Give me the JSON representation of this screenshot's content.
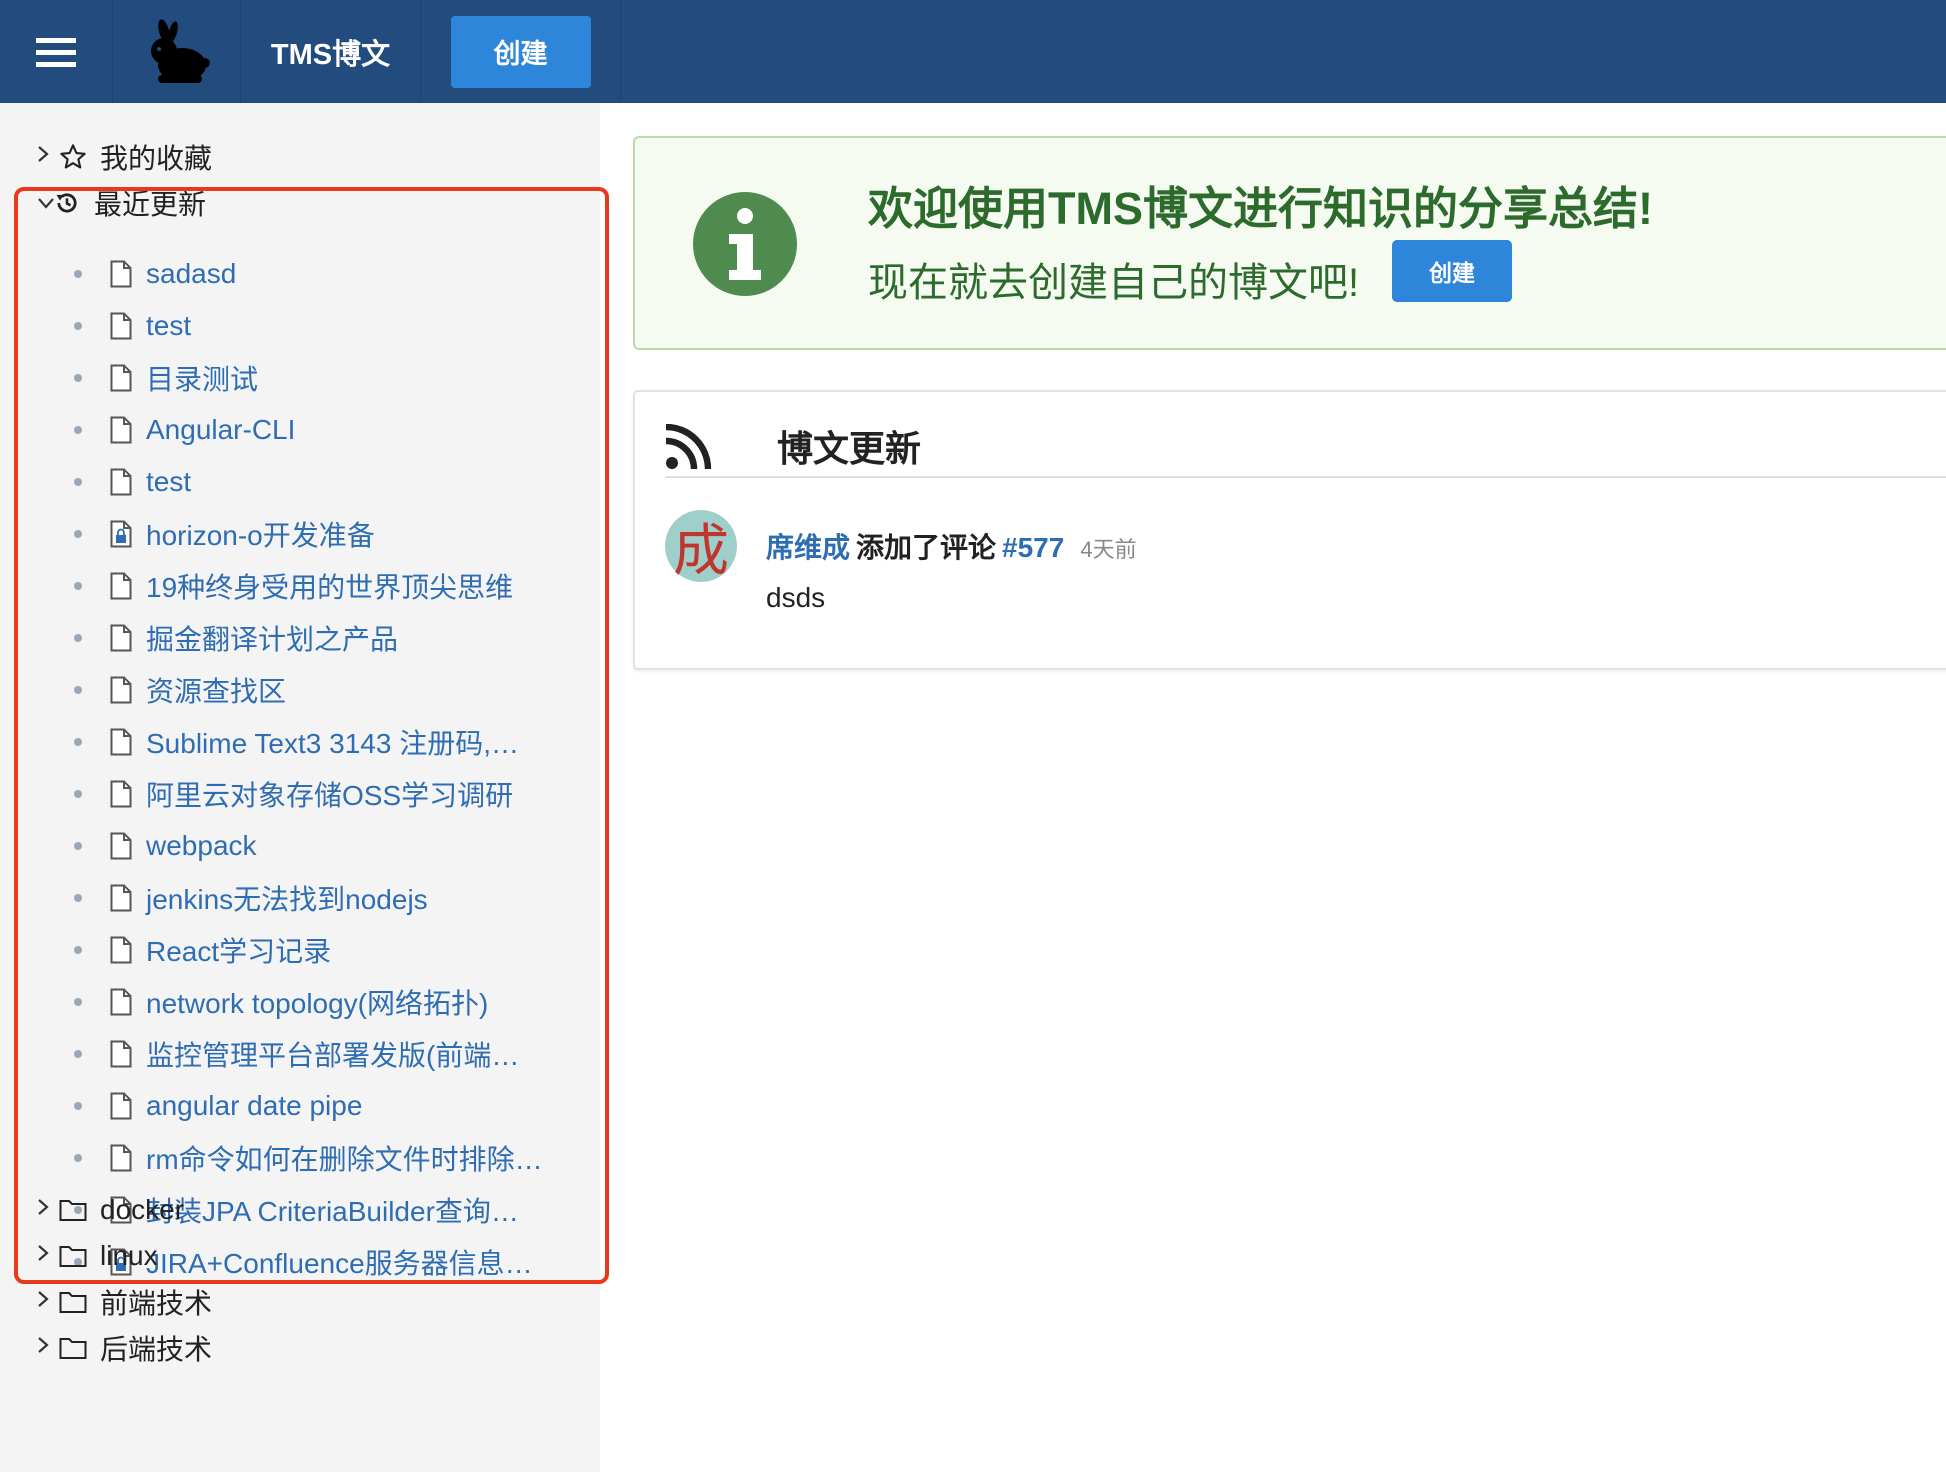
{
  "header": {
    "title": "TMS博文",
    "create_label": "创建",
    "menu_icon": "hamburger-icon",
    "logo_icon": "rabbit-logo"
  },
  "sidebar": {
    "favorites_label": "我的收藏",
    "recent_label": "最近更新",
    "recent_items": [
      {
        "label": "sadasd",
        "icon": "document-icon"
      },
      {
        "label": "test",
        "icon": "document-icon"
      },
      {
        "label": "目录测试",
        "icon": "document-icon"
      },
      {
        "label": "Angular-CLI",
        "icon": "document-icon"
      },
      {
        "label": "test",
        "icon": "document-icon"
      },
      {
        "label": "horizon-o开发准备",
        "icon": "locked-document-icon"
      },
      {
        "label": "19种终身受用的世界顶尖思维",
        "icon": "document-icon"
      },
      {
        "label": "掘金翻译计划之产品",
        "icon": "document-icon"
      },
      {
        "label": "资源查找区",
        "icon": "document-icon"
      },
      {
        "label": "Sublime Text3 3143 注册码,…",
        "icon": "document-icon"
      },
      {
        "label": "阿里云对象存储OSS学习调研",
        "icon": "document-icon"
      },
      {
        "label": "webpack",
        "icon": "document-icon"
      },
      {
        "label": "jenkins无法找到nodejs",
        "icon": "document-icon"
      },
      {
        "label": "React学习记录",
        "icon": "document-icon"
      },
      {
        "label": "network topology(网络拓扑)",
        "icon": "document-icon"
      },
      {
        "label": "监控管理平台部署发版(前端…",
        "icon": "document-icon"
      },
      {
        "label": "angular date pipe",
        "icon": "document-icon"
      },
      {
        "label": "rm命令如何在删除文件时排除…",
        "icon": "document-icon"
      },
      {
        "label": "封装JPA CriteriaBuilder查询…",
        "icon": "document-icon"
      },
      {
        "label": "JIRA+Confluence服务器信息…",
        "icon": "locked-document-icon"
      }
    ],
    "folders": [
      {
        "label": "docker"
      },
      {
        "label": "linux"
      },
      {
        "label": "前端技术"
      },
      {
        "label": "后端技术"
      }
    ]
  },
  "welcome": {
    "title": "欢迎使用TMS博文进行知识的分享总结!",
    "subtitle": "现在就去创建自己的博文吧!",
    "create_label": "创建"
  },
  "feed": {
    "title": "博文更新",
    "entries": [
      {
        "avatar_char": "成",
        "user": "席维成",
        "action": "添加了评论",
        "ref": "#577",
        "time": "4天前",
        "body": "dsds"
      }
    ]
  },
  "colors": {
    "topbar": "#234c7e",
    "primary_button": "#2d86d9",
    "link": "#2f6db3",
    "highlight_border": "#e8391d",
    "welcome_text": "#2c6b2c",
    "info_icon": "#4f8a4f"
  }
}
